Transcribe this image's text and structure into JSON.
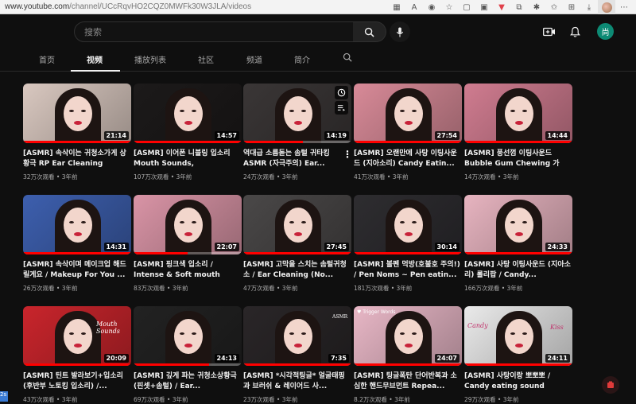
{
  "browser": {
    "url_host": "www.youtube.com",
    "url_path": "/channel/UCcRqvHO2CQZ0MWFk30W3JLA/videos"
  },
  "header": {
    "search_placeholder": "搜索",
    "profile_initial": "尚"
  },
  "tabs": [
    {
      "label": "首页"
    },
    {
      "label": "视频"
    },
    {
      "label": "播放列表"
    },
    {
      "label": "社区"
    },
    {
      "label": "频道"
    },
    {
      "label": "简介"
    }
  ],
  "videos": [
    {
      "title": "[ASMR] 속삭이는 귀청소가게 상황극 RP Ear Cleaning",
      "meta": "32万次观看 • 3年前",
      "duration": "21:14",
      "progress": 1.0,
      "bg": "#d9c8c0"
    },
    {
      "title": "[ASMR] 이어폰 니블링 입소리 Mouth Sounds, Earphone...",
      "meta": "107万次观看 • 3年前",
      "duration": "14:57",
      "progress": 1.0,
      "bg": "#1c1a1a"
    },
    {
      "title": "역대급 소름돋는 솜털 귀타킹 ASMR (자극주의) Ear...",
      "meta": "24万次观看 • 3年前",
      "duration": "14:19",
      "progress": 0.55,
      "bg": "#3a3636"
    },
    {
      "title": "[ASMR] 오랜만에 사탕 이팅사운드 (지아소리) Candy Eatin...",
      "meta": "41万次观看 • 3年前",
      "duration": "27:54",
      "progress": 1.0,
      "bg": "#d88a98"
    },
    {
      "title": "[ASMR] 풍선껌 이팅사운드 Bubble Gum Chewing 가ム...",
      "meta": "14万次观看 • 3年前",
      "duration": "14:44",
      "progress": 1.0,
      "bg": "#d07c90"
    },
    {
      "title": "[ASMR] 속삭이며 메이크업 해드릴게요 / Makeup For You ...",
      "meta": "26万次观看 • 3年前",
      "duration": "14:31",
      "progress": 1.0,
      "bg": "#3d5fae"
    },
    {
      "title": "[ASMR] 핑크색 입소리 / Intense & Soft mouth sound...",
      "meta": "83万次观看 • 3年前",
      "duration": "22:07",
      "progress": 0.5,
      "bg": "#d994a6"
    },
    {
      "title": "[ASMR] 고막을 스치는 솜털귀청소 / Ear Cleaning (No...",
      "meta": "47万次观看 • 3年前",
      "duration": "27:45",
      "progress": 1.0,
      "bg": "#4a4848"
    },
    {
      "title": "[ASMR] 볼펜 먹방(호불호 주의!) / Pen Noms ~ Pen eatin...",
      "meta": "181万次观看 • 3年前",
      "duration": "30:14",
      "progress": 1.0,
      "bg": "#2e2d30"
    },
    {
      "title": "[ASMR] 사탕 이팅사운드 (지아소리) 롤리팝 / Candy...",
      "meta": "166万次观看 • 3年前",
      "duration": "24:33",
      "progress": 1.0,
      "bg": "#e7b4c0"
    },
    {
      "title": "[ASMR] 틴트 발라보기+입소리 (후반부 노토킹 입소리) /...",
      "meta": "43万次观看 • 3年前",
      "duration": "20:09",
      "progress": 1.0,
      "bg": "#c9252c"
    },
    {
      "title": "[ASMR] 깊게 파는 귀청소상황극 (핀셋+솜털) / Ear...",
      "meta": "69万次观看 • 3年前",
      "duration": "24:13",
      "progress": 0.7,
      "bg": "#222"
    },
    {
      "title": "[ASMR] *시각적팅글* 얼굴태핑과 브러쉬 & 레이어드 사...",
      "meta": "23万次观看 • 3年前",
      "duration": "7:35",
      "progress": 1.0,
      "bg": "#2a2628"
    },
    {
      "title": "[ASMR] 팅글폭탄 단어반복과 소심한 핸드무브먼트 Repea...",
      "meta": "8.2万次观看 • 3年前",
      "duration": "24:07",
      "progress": 1.0,
      "bg": "#e8b7c6"
    },
    {
      "title": "[ASMR] 사탕이랑 뽀뽀뽀 / Candy eating sound",
      "meta": "29万次观看 • 3年前",
      "duration": "24:11",
      "progress": 1.0,
      "bg": "#eaeaea"
    }
  ],
  "thumb_texts": {
    "mouth_sounds": "Mouth Sounds",
    "candy": "Candy",
    "kiss": "Kiss",
    "trigger_words": "♥ Trigger Words",
    "asmr": "ASMR"
  }
}
